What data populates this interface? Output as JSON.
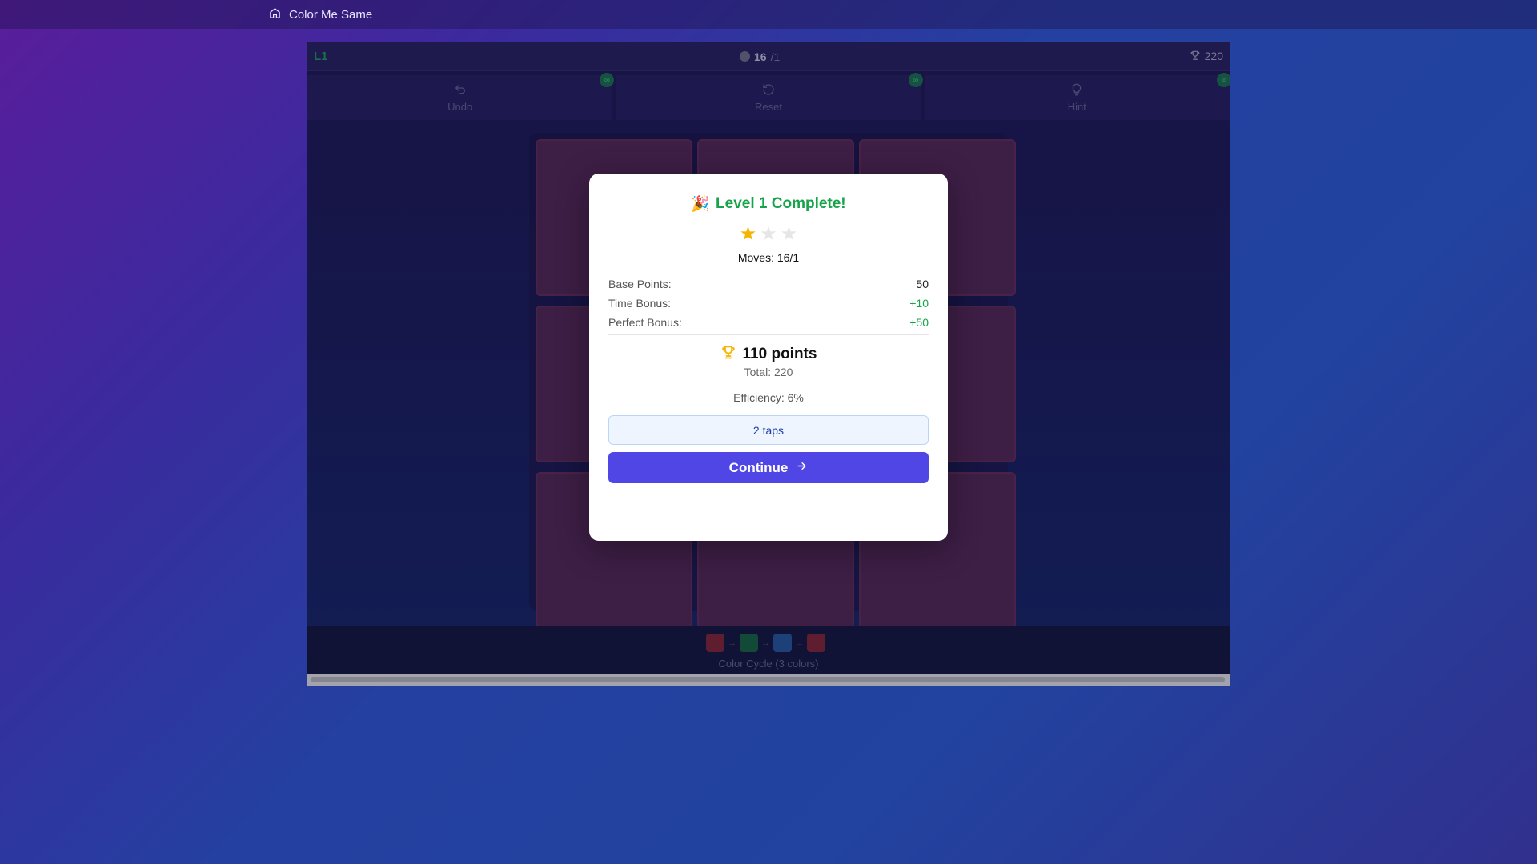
{
  "topbar": {
    "app_title": "Color Me Same",
    "home_icon": "home-icon"
  },
  "game": {
    "level_label": "L1",
    "moves_made": "16",
    "moves_par": "/1",
    "score": "220",
    "toolbar": [
      {
        "label": "Undo",
        "icon": "undo-icon",
        "badge": "∞"
      },
      {
        "label": "Reset",
        "icon": "reset-icon",
        "badge": "∞"
      },
      {
        "label": "Hint",
        "icon": "lightbulb-icon",
        "badge": "∞"
      }
    ],
    "board": {
      "rows": 3,
      "cols": 3,
      "tile_color": "#5a2a55"
    },
    "color_cycle": {
      "swatches": [
        "#8e2a35",
        "#1a6e3f",
        "#2a5fa5",
        "#8e2a35"
      ],
      "label": "Color Cycle (3 colors)"
    }
  },
  "modal": {
    "emoji": "🎉",
    "title": "Level 1 Complete!",
    "stars_earned": 1,
    "stars_total": 3,
    "moves_line": "Moves: 16/1",
    "breakdown": [
      {
        "label": "Base Points:",
        "value": "50",
        "positive": false
      },
      {
        "label": "Time Bonus:",
        "value": "+10",
        "positive": true
      },
      {
        "label": "Perfect Bonus:",
        "value": "+50",
        "positive": true
      }
    ],
    "points": "110 points",
    "total": "Total: 220",
    "efficiency": "Efficiency: 6%",
    "taps": "2 taps",
    "continue_label": "Continue"
  },
  "colors": {
    "accent": "#4f46e5",
    "success": "#16a34a",
    "star": "#f5b400"
  }
}
